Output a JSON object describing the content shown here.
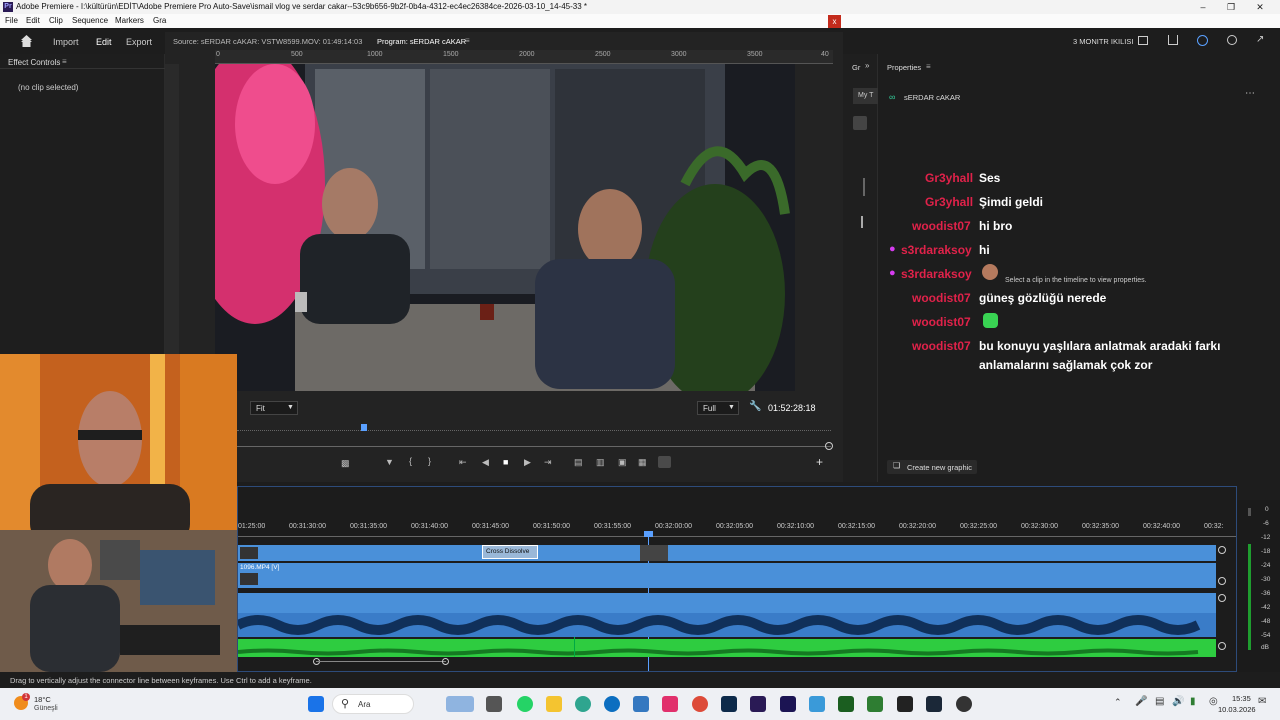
{
  "window": {
    "title": "Adobe Premiere - I:\\kültürün\\EDİT\\Adobe Premiere Pro Auto-Save\\ismail vlog ve serdar cakar--53c9b656-9b2f-0b4a-4312-ec4ec26384ce-2026-03-10_14-45-33 *",
    "app_icon": "Pr"
  },
  "menu": [
    "File",
    "Edit",
    "Clip",
    "Sequence",
    "Markers",
    "Gra"
  ],
  "workspace": {
    "home_icon": "home-icon",
    "tabs": [
      "Import",
      "Edit",
      "Export"
    ],
    "active_tab": "Edit",
    "right_label": "3 MONITR IKILISI"
  },
  "effect_controls": {
    "title": "Effect Controls",
    "empty_text": "(no clip selected)"
  },
  "monitor": {
    "source_tab": "Source: sERDAR cAKAR: VSTW8599.MOV: 01:49:14:03",
    "program_tab": "Program: sERDAR cAKAR",
    "ruler_labels": [
      "0",
      "500",
      "1000",
      "1500",
      "2000",
      "2500",
      "3000",
      "3500",
      "40"
    ],
    "zoom_value": "Fit",
    "quality_value": "Full",
    "timecode": "01:52:28:18"
  },
  "properties": {
    "title": "Properties",
    "left_tab": "Gr",
    "my_tab": "My T",
    "sequence_name": "sERDAR cAKAR",
    "hint": "Select a clip in the timeline to view properties.",
    "create_button": "Create new graphic"
  },
  "chat": [
    {
      "user": "Gr3yhall",
      "msg": "Ses",
      "badge": false
    },
    {
      "user": "Gr3yhall",
      "msg": "Şimdi geldi",
      "badge": false
    },
    {
      "user": "woodist07",
      "msg": "hi bro",
      "badge": false
    },
    {
      "user": "s3rdaraksoy",
      "msg": "hi",
      "badge": true
    },
    {
      "user": "s3rdaraksoy",
      "msg": "",
      "badge": true,
      "emote": "face-emote"
    },
    {
      "user": "woodist07",
      "msg": "güneş gözlüğü nerede",
      "badge": false
    },
    {
      "user": "woodist07",
      "msg": "",
      "badge": false,
      "emote": "green-emote"
    },
    {
      "user": "woodist07",
      "msg": "bu konuyu yaşlılara anlatmak aradaki farkı",
      "badge": false
    },
    {
      "user": "",
      "msg": "anlamalarını sağlamak çok zor",
      "badge": false
    }
  ],
  "timeline": {
    "timecodes": [
      "01:25:00",
      "00:31:30:00",
      "00:31:35:00",
      "00:31:40:00",
      "00:31:45:00",
      "00:31:50:00",
      "00:31:55:00",
      "00:32:00:00",
      "00:32:05:00",
      "00:32:10:00",
      "00:32:15:00",
      "00:32:20:00",
      "00:32:25:00",
      "00:32:30:00",
      "00:32:35:00",
      "00:32:40:00",
      "00:32:"
    ],
    "transition_label": "Cross Dissolve",
    "clip_label": "1096.MP4 [V]"
  },
  "meter_labels": [
    "0",
    "-6",
    "-12",
    "-18",
    "-24",
    "-30",
    "-36",
    "-42",
    "-48",
    "-54",
    "dB"
  ],
  "status_text": "Drag to vertically adjust the connector line between keyframes. Use Ctrl to add a keyframe.",
  "taskbar": {
    "weather_temp": "18°C",
    "weather_desc": "Güneşli",
    "search_placeholder": "Ara",
    "time": "15:35",
    "date": "10.03.2026",
    "badge_count": "1"
  },
  "colors": {
    "accent": "#4a90d9",
    "chat_user": "#e0224a",
    "audio_green": "#2ecc40"
  }
}
